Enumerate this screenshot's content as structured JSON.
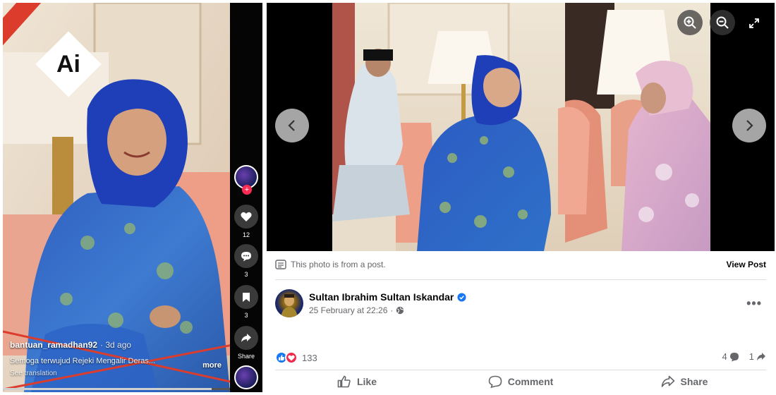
{
  "tiktok": {
    "ai_badge": "Ai",
    "username": "bantuan_ramadhan92",
    "posted_ago": "· 3d ago",
    "caption": "Semoga terwujud Rejeki Mengalir Deras...",
    "more_label": "more",
    "see_translation": "See translation",
    "likes_count": "12",
    "comments_count": "3",
    "saves_count": "3",
    "share_label": "Share",
    "progress": 0.92
  },
  "facebook": {
    "from_post_text": "This photo is from a post.",
    "view_post_label": "View Post",
    "author_name": "Sultan Ibrahim Sultan Iskandar",
    "post_time": "25 February at 22:26",
    "more_label": "•••",
    "reaction_count": "133",
    "comments_count": "4",
    "shares_count": "1",
    "actions": {
      "like": "Like",
      "comment": "Comment",
      "share": "Share"
    },
    "colors": {
      "like_blue": "#1877f2",
      "love_red": "#f0284a",
      "secondary_text": "#65676b"
    }
  }
}
